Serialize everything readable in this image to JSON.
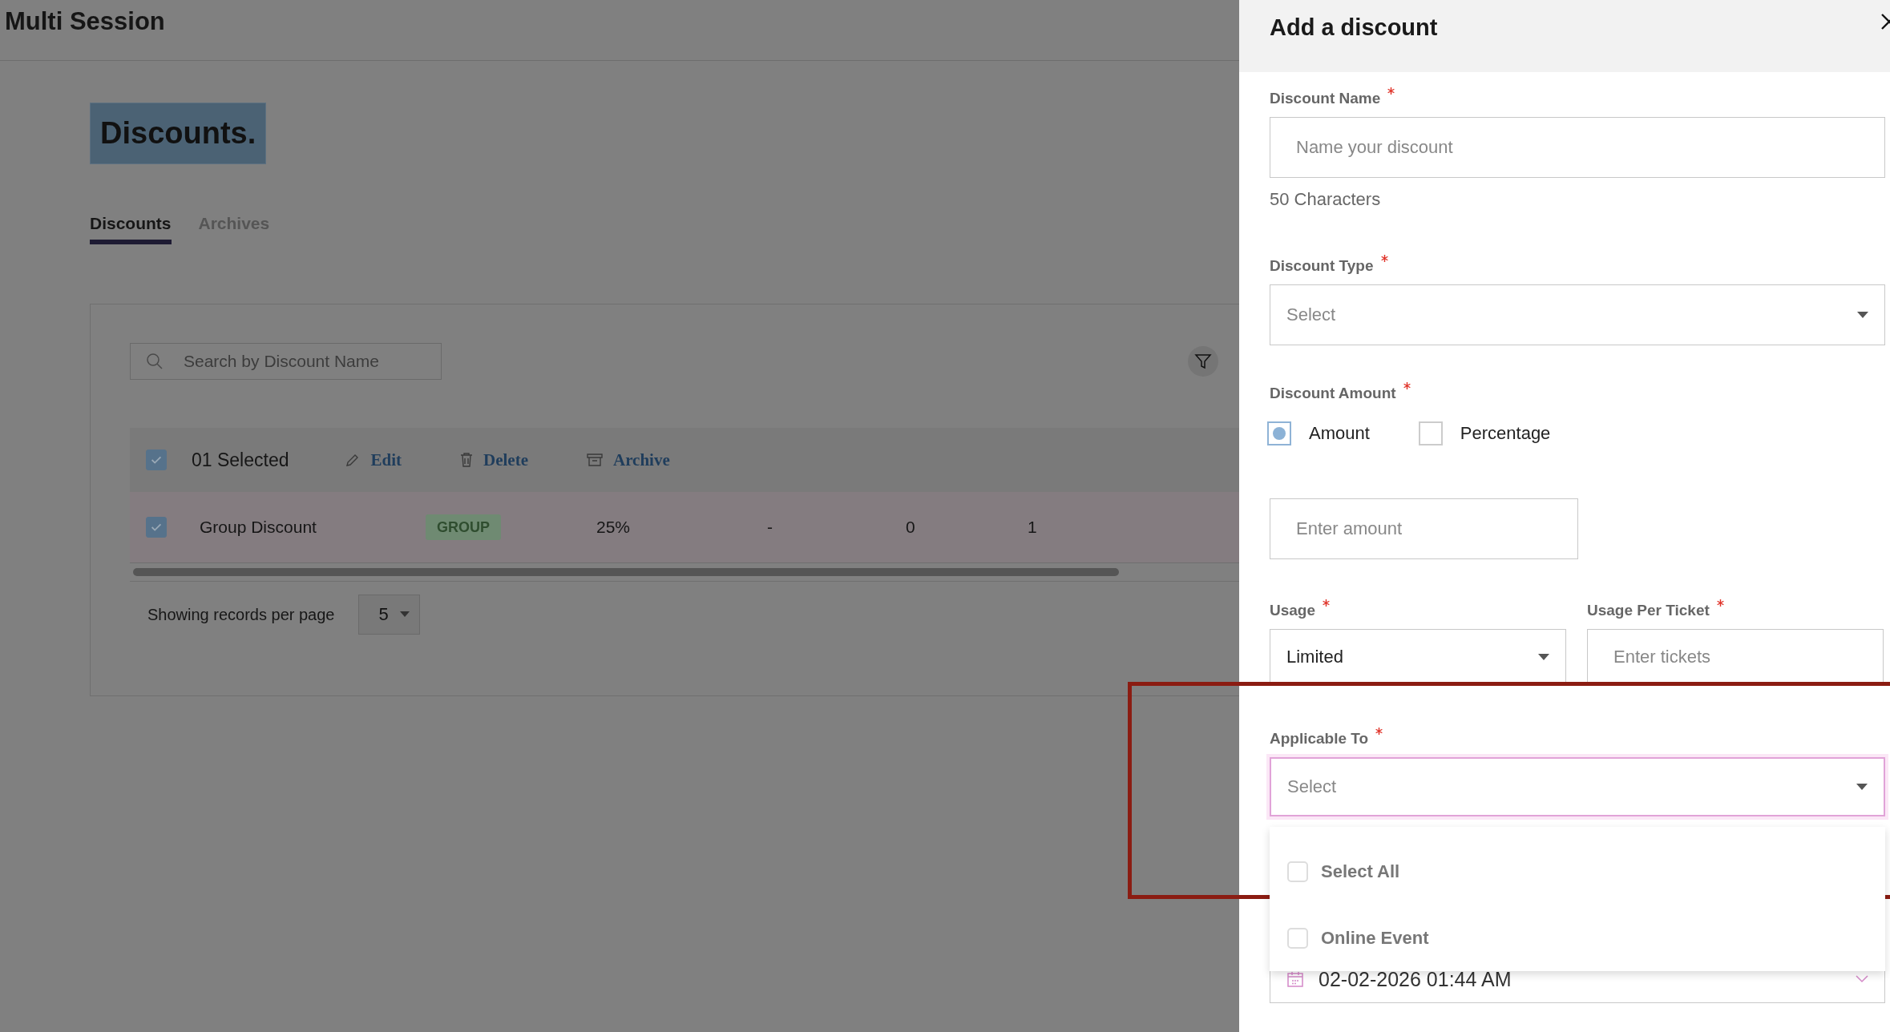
{
  "app_title": "Multi Session",
  "page_heading": "Discounts.",
  "tabs": [
    {
      "label": "Discounts",
      "selected": true
    },
    {
      "label": "Archives",
      "selected": false
    }
  ],
  "search": {
    "placeholder": "Search by Discount Name"
  },
  "bulk_bar": {
    "checked": true,
    "count": "01 Selected",
    "actions": [
      {
        "label": "Edit"
      },
      {
        "label": "Delete"
      },
      {
        "label": "Archive"
      }
    ]
  },
  "table": {
    "rows": [
      {
        "checked": true,
        "cells": [
          {
            "kind": "text",
            "text": "Group Discount"
          },
          {
            "kind": "badge",
            "text": "GROUP"
          },
          {
            "kind": "text",
            "text": "25%"
          },
          {
            "kind": "text",
            "text": "-"
          },
          {
            "kind": "text",
            "text": "0"
          },
          {
            "kind": "text",
            "text": "1"
          }
        ]
      }
    ]
  },
  "pagination": {
    "label": "Showing records per page",
    "value": "5"
  },
  "panel": {
    "title": "Add a discount",
    "fields": [
      {
        "kind": "text",
        "label": "Discount Name",
        "required": true,
        "placeholder": "Name your discount",
        "hint": "50 Characters"
      },
      {
        "kind": "select",
        "label": "Discount Type",
        "required": true,
        "placeholder": "Select"
      },
      {
        "kind": "choice",
        "label": "Discount Amount",
        "required": true,
        "options": [
          {
            "label": "Amount",
            "selected": true
          },
          {
            "label": "Percentage",
            "selected": false
          }
        ]
      },
      {
        "kind": "text",
        "placeholder": "Enter amount"
      },
      {
        "kind": "pair",
        "items": [
          {
            "kind": "select",
            "label": "Usage",
            "required": true,
            "value": "Limited"
          },
          {
            "kind": "text",
            "label": "Usage Per Ticket",
            "required": true,
            "placeholder": "Enter tickets"
          }
        ]
      },
      {
        "kind": "select",
        "label": "Applicable To",
        "required": true,
        "placeholder": "Select",
        "focused": true,
        "open": true,
        "options": [
          {
            "label": "Select All",
            "checked": false
          },
          {
            "label": "Online Event",
            "checked": false
          }
        ]
      },
      {
        "kind": "date",
        "value": "02-02-2026 01:44 AM"
      }
    ]
  }
}
